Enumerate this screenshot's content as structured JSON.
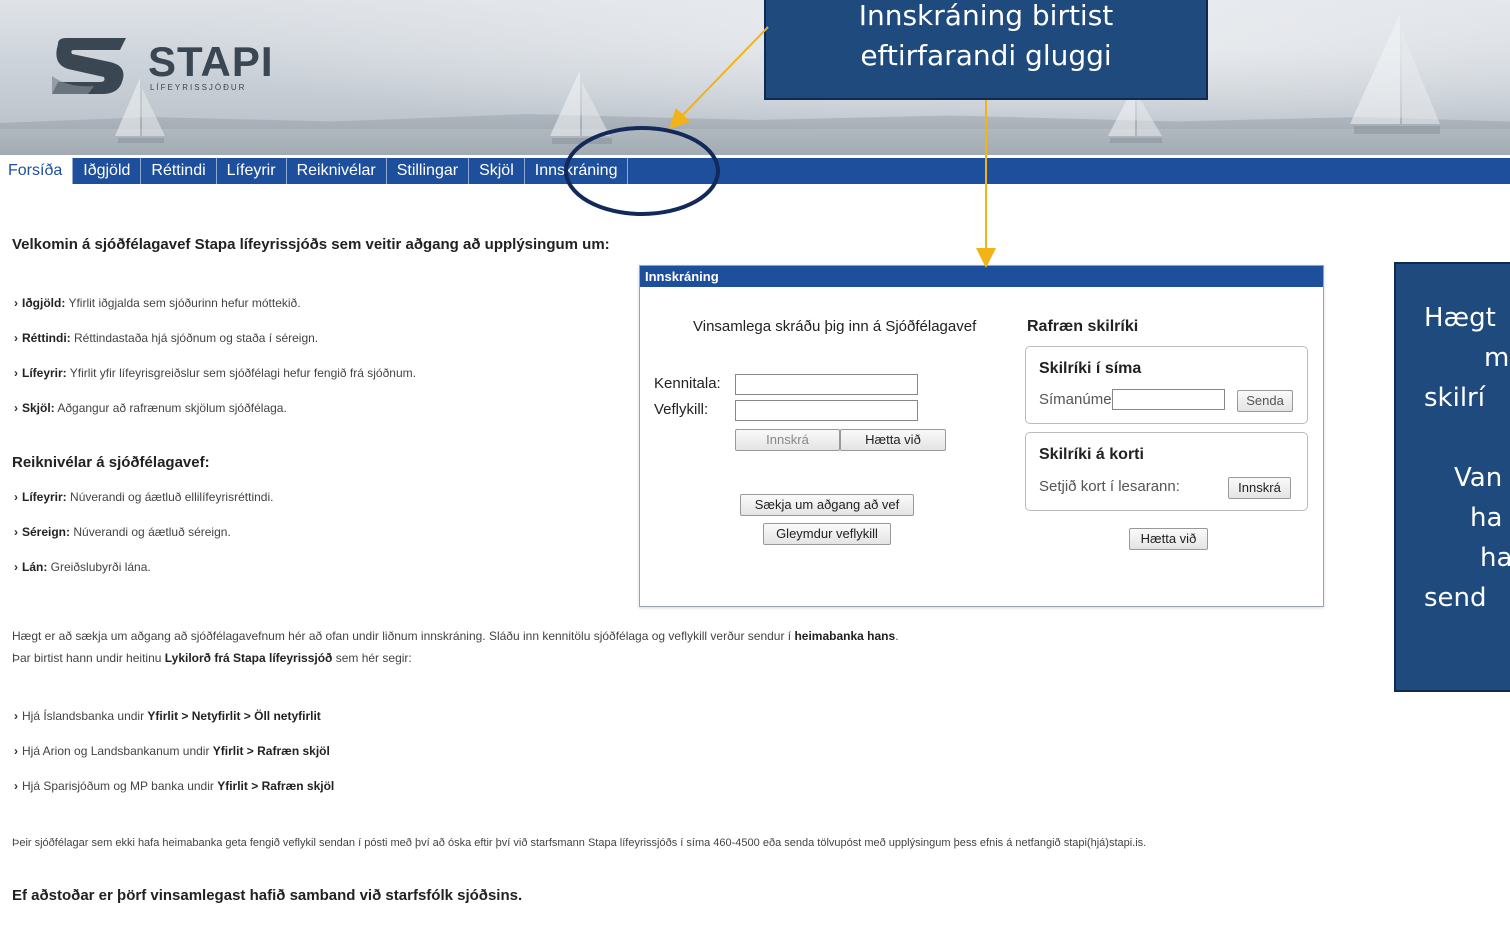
{
  "header": {
    "logo_text": "STAPI",
    "logo_sub": "LÍFEYRISSJÓÐUR"
  },
  "nav": {
    "items": [
      "Forsíða",
      "Iðgjöld",
      "Réttindi",
      "Lífeyrir",
      "Reiknivélar",
      "Stillingar",
      "Skjöl",
      "Innskráning"
    ],
    "active": "Forsíða"
  },
  "main": {
    "welcome": "Velkomin á sjóðfélagavef Stapa lífeyrissjóðs sem veitir aðgang að upplýsingum um:",
    "bullets": [
      {
        "term": "Iðgjöld:",
        "text": " Yfirlit iðgjalda sem sjóðurinn hefur móttekið."
      },
      {
        "term": "Réttindi:",
        "text": " Réttindastaða hjá sjóðnum og staða í séreign."
      },
      {
        "term": "Lífeyrir:",
        "text": " Yfirlit yfir lífeyrisgreiðslur sem sjóðfélagi hefur fengið frá sjóðnum."
      },
      {
        "term": "Skjöl:",
        "text": " Aðgangur að rafrænum skjölum sjóðfélaga."
      }
    ],
    "reiknivelar_heading": "Reiknivélar á sjóðfélagavef:",
    "reiknivelar": [
      {
        "term": "Lífeyrir:",
        "text": " Núverandi og áætluð ellilífeyrisréttindi."
      },
      {
        "term": "Séreign:",
        "text": " Núverandi og áætluð séreign."
      },
      {
        "term": "Lán:",
        "text": " Greiðslubyrði lána."
      }
    ],
    "para1_a": "Hægt er að sækja um aðgang að sjóðfélagavefnum hér að ofan undir liðnum innskráning. Sláðu inn kennitölu sjóðfélaga og veflykill verður sendur í ",
    "para1_b": "heimabanka hans",
    "para1_c": ".",
    "para2_a": "Þar birtist hann undir heitinu ",
    "para2_b": "Lykilorð frá Stapa lífeyrissjóð",
    "para2_c": " sem hér segir:",
    "banks": [
      {
        "pre": "Hjá Íslandsbanka undir ",
        "path": "Yfirlit > Netyfirlit > Öll netyfirlit"
      },
      {
        "pre": "Hjá Arion og Landsbankanum undir ",
        "path": "Yfirlit > Rafræn skjöl"
      },
      {
        "pre": "Hjá Sparisjóðum og MP banka undir ",
        "path": "Yfirlit > Rafræn skjöl"
      }
    ],
    "para3": "Þeir sjóðfélagar sem ekki hafa heimabanka geta fengið veflykil sendan í pósti með því að óska eftir því við starfsmann Stapa lífeyrissjóðs í síma 460-4500 eða senda tölvupóst með upplýsingum þess efnis á netfangið stapi(hjá)stapi.is.",
    "footer": "Ef aðstoðar er þörf vinsamlegast hafið samband við starfsfólk sjóðsins."
  },
  "dialog": {
    "title": "Innskráning",
    "intro": "Vinsamlega skráðu þig inn á Sjóðfélagavef",
    "kennitala_label": "Kennitala:",
    "kennitala_value": "",
    "veflykill_label": "Veflykill:",
    "veflykill_value": "",
    "login_btn": "Innskrá",
    "cancel_btn": "Hætta við",
    "apply_btn": "Sækja um aðgang að vef",
    "forgot_btn": "Gleymdur veflykill",
    "rafraen_title": "Rafræn skilríki",
    "phone_title": "Skilríki í síma",
    "phone_label": "Símanúmer:",
    "phone_value": "",
    "send_btn": "Senda",
    "card_title": "Skilríki á korti",
    "card_label": "Setjið kort í lesarann:",
    "card_btn": "Innskrá",
    "cancel2_btn": "Hætta við"
  },
  "callouts": {
    "top_line1": "Innskráning birtist",
    "top_line2": "eftirfarandi gluggi",
    "right_lines": [
      "Hægt",
      "m",
      "skilrí",
      "",
      "Van",
      "ha",
      "ha",
      "send"
    ]
  },
  "colors": {
    "nav": "#1e4f9c",
    "callout": "#1e4a7e",
    "arrow": "#f2b316"
  }
}
